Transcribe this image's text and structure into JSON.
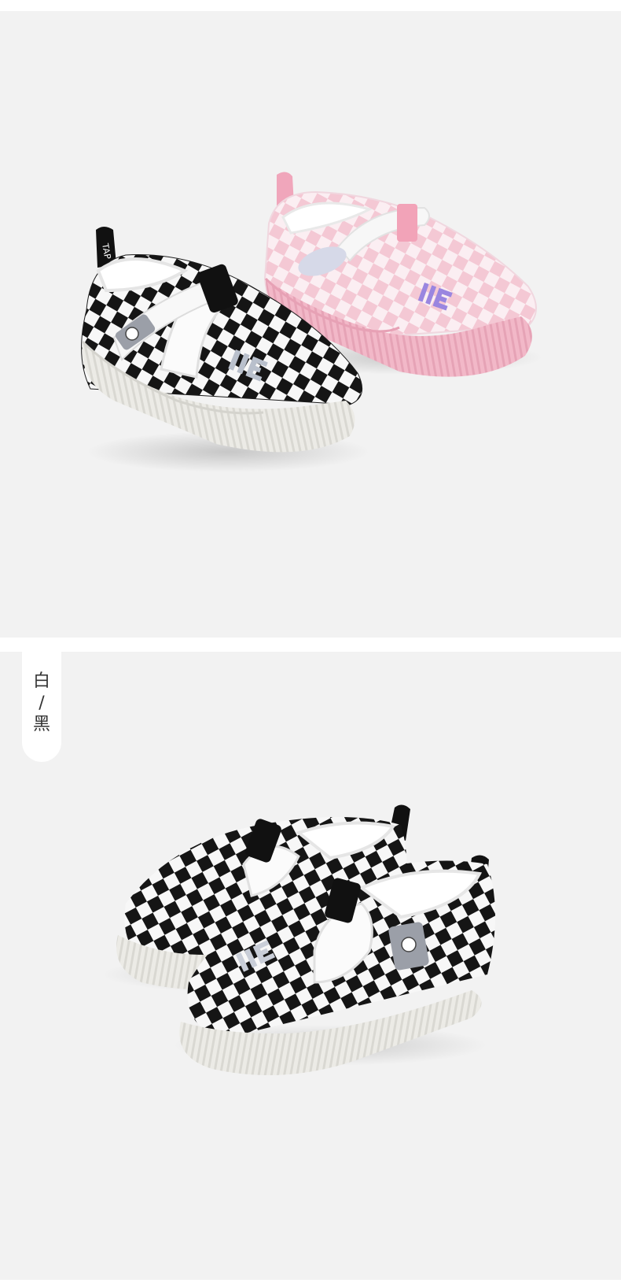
{
  "color_tag": {
    "top": "白",
    "sep": "/",
    "bottom": "黑"
  },
  "heel_tab_text": "TAP",
  "colors": {
    "background": "#f2f2f2",
    "black_check": "#151515",
    "white_check": "#f7f7f7",
    "pink_check": "#f4c8d4",
    "pink_sole": "#f2b8c8",
    "cream_sole": "#ecebe6",
    "purple_logo": "#9a86e0"
  }
}
